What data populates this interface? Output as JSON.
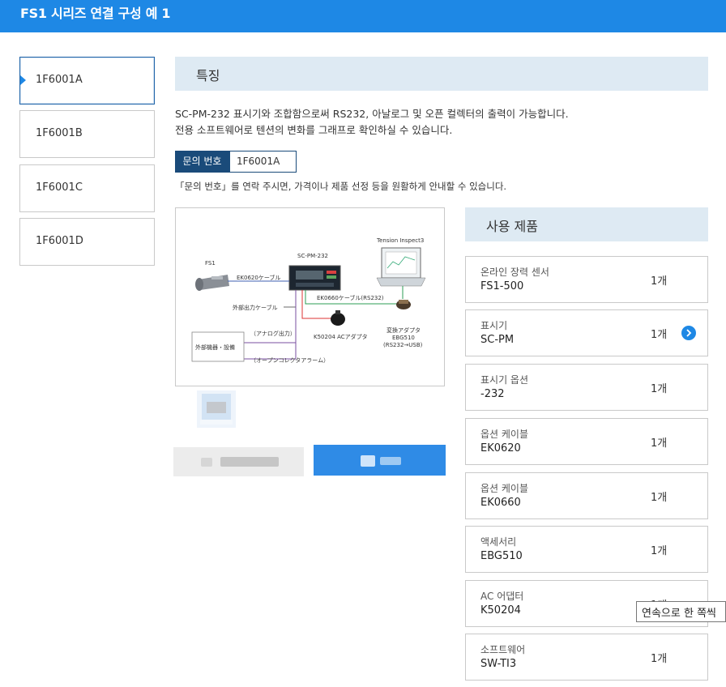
{
  "header": {
    "title": "FS1 시리즈 연결 구성 예 1"
  },
  "tabs": [
    {
      "label": "1F6001A",
      "active": true
    },
    {
      "label": "1F6001B",
      "active": false
    },
    {
      "label": "1F6001C",
      "active": false
    },
    {
      "label": "1F6001D",
      "active": false
    }
  ],
  "features": {
    "heading": "특징",
    "desc_line1": "SC-PM-232 표시기와 조합함으로써 RS232, 아날로그 및 오픈 컬렉터의 출력이 가능합니다.",
    "desc_line2": "전용 소프트웨어로 텐션의 변화를 그래프로 확인하실 수 있습니다.",
    "inquiry_label": "문의 번호",
    "inquiry_value": "1F6001A",
    "note": "「문의 번호」를 연락 주시면, 가격이나 제품 선정 등을 원활하게 안내할 수 있습니다."
  },
  "diagram": {
    "fs1": "FS1",
    "sc_pm": "SC-PM-232",
    "tension_inspect": "Tension Inspect3",
    "ek0620": "EK0620ケーブル",
    "ek0660": "EK0660ケーブル(RS232)",
    "ext_cable": "外部出力ケーブル",
    "analog_out": "（アナログ出力）",
    "ext_device": "外部機器・設備",
    "open_collector": "（オープンコレクタアラーム）",
    "adapter": "K50204 ACアダプタ",
    "conv1": "変換アダプタ",
    "conv2": "EBG510",
    "conv3": "(RS232→USB)"
  },
  "products": {
    "heading": "사용 제품",
    "items": [
      {
        "category": "온라인 장력 센서",
        "name": "FS1-500",
        "qty": "1개",
        "has_link": false
      },
      {
        "category": "표시기",
        "name": "SC-PM",
        "qty": "1개",
        "has_link": true
      },
      {
        "category": "표시기 옵션",
        "name": "-232",
        "qty": "1개",
        "has_link": false
      },
      {
        "category": "옵션 케이블",
        "name": "EK0620",
        "qty": "1개",
        "has_link": false
      },
      {
        "category": "옵션 케이블",
        "name": "EK0660",
        "qty": "1개",
        "has_link": false
      },
      {
        "category": "액세서리",
        "name": "EBG510",
        "qty": "1개",
        "has_link": false
      },
      {
        "category": "AC 어댑터",
        "name": "K50204",
        "qty": "1개",
        "has_link": false
      },
      {
        "category": "소프트웨어",
        "name": "SW-TI3",
        "qty": "1개",
        "has_link": false
      }
    ]
  },
  "tooltip": {
    "text": "연속으로 한 쪽씩"
  },
  "colors": {
    "primary": "#1e88e5",
    "navy": "#1a4b7a",
    "section_bg": "#deeaf3"
  },
  "icons": [
    "chevron-right-icon",
    "tab-marker-icon"
  ]
}
